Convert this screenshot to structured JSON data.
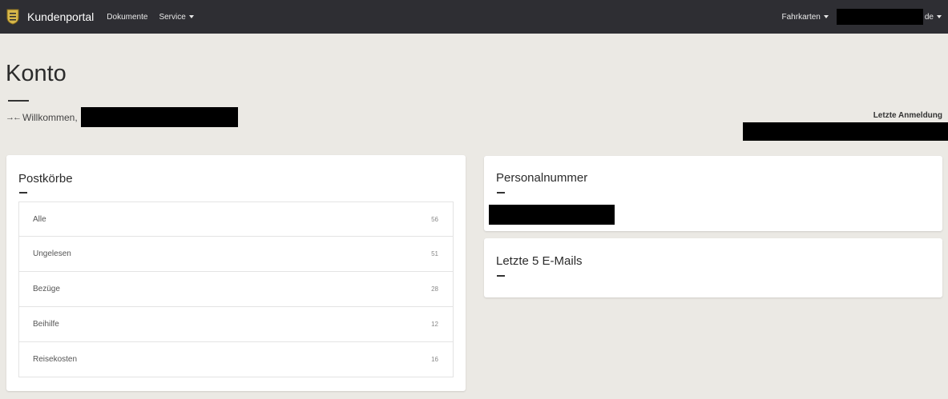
{
  "navbar": {
    "brand": "Kundenportal",
    "links": [
      "Dokumente",
      "Service"
    ],
    "right_menu": "Fahrkarten",
    "user_suffix": "de"
  },
  "header": {
    "title": "Konto",
    "welcome": "Willkommen,",
    "last_login_label": "Letzte Anmeldung"
  },
  "postkoerbe": {
    "title": "Postkörbe",
    "items": [
      {
        "label": "Alle",
        "count": "56"
      },
      {
        "label": "Ungelesen",
        "count": "51"
      },
      {
        "label": "Bezüge",
        "count": "28"
      },
      {
        "label": "Beihilfe",
        "count": "12"
      },
      {
        "label": "Reisekosten",
        "count": "16"
      }
    ]
  },
  "personalnummer": {
    "title": "Personalnummer"
  },
  "emails": {
    "title": "Letzte 5 E-Mails"
  }
}
